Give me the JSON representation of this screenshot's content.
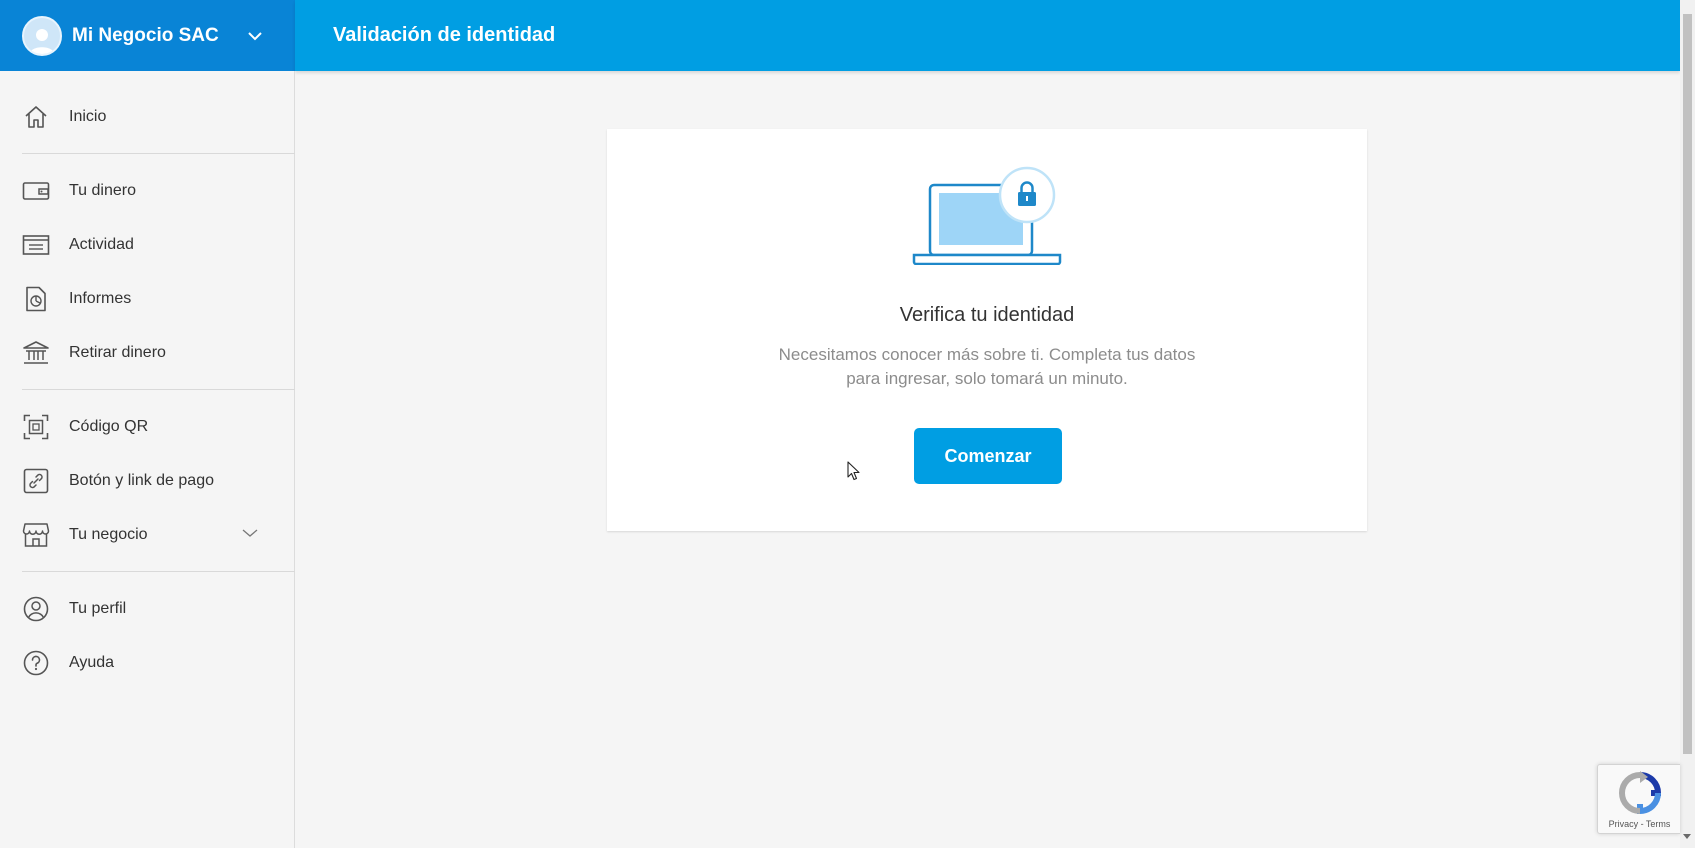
{
  "header": {
    "account_name": "Mi Negocio SAC",
    "page_title": "Validación de identidad"
  },
  "sidebar": {
    "items": [
      {
        "label": "Inicio",
        "icon": "home-icon"
      },
      {
        "label": "Tu dinero",
        "icon": "wallet-icon"
      },
      {
        "label": "Actividad",
        "icon": "list-icon"
      },
      {
        "label": "Informes",
        "icon": "report-icon"
      },
      {
        "label": "Retirar dinero",
        "icon": "bank-icon"
      },
      {
        "label": "Código QR",
        "icon": "qr-code-icon"
      },
      {
        "label": "Botón y link de pago",
        "icon": "link-icon"
      },
      {
        "label": "Tu negocio",
        "icon": "store-icon"
      },
      {
        "label": "Tu perfil",
        "icon": "user-icon"
      },
      {
        "label": "Ayuda",
        "icon": "help-icon"
      }
    ]
  },
  "card": {
    "title": "Verifica tu identidad",
    "description": "Necesitamos conocer más sobre ti. Completa tus datos para ingresar, solo tomará un minuto.",
    "button_label": "Comenzar"
  },
  "recaptcha": {
    "links": "Privacy - Terms"
  },
  "colors": {
    "header_blue": "#009ee3",
    "account_blue": "#0984d6",
    "primary_button": "#009ee3",
    "background": "#f5f5f5"
  }
}
